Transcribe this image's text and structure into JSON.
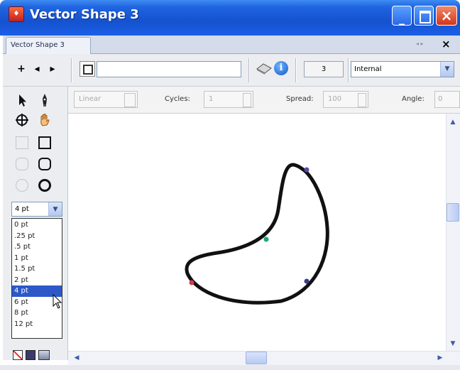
{
  "window": {
    "title": "Vector Shape 3",
    "icon": "app-logo-icon"
  },
  "panel_tab": {
    "label": "Vector Shape 3"
  },
  "toolbar": {
    "name_value": "",
    "points_count": "3",
    "placement": "Internal",
    "nav_add_label": "+",
    "nav_prev_label": "◂",
    "nav_next_label": "▸"
  },
  "gradient_options": {
    "type_value": "Linear",
    "cycles_label": "Cycles:",
    "cycles_value": "1",
    "spread_label": "Spread:",
    "spread_value": "100",
    "angle_label": "Angle:",
    "angle_value": "0"
  },
  "stroke_width": {
    "selected": "4 pt",
    "options": [
      "0 pt",
      ".25 pt",
      ".5 pt",
      "1 pt",
      "1.5 pt",
      "2 pt",
      "4 pt",
      "6 pt",
      "8 pt",
      "12 pt"
    ],
    "selected_index": 6
  },
  "shape_handle_colors": {
    "top": "#5a4aa8",
    "middle": "#1aa878",
    "bottom_left": "#d23a4a",
    "bottom_right": "#3a3a8a"
  }
}
